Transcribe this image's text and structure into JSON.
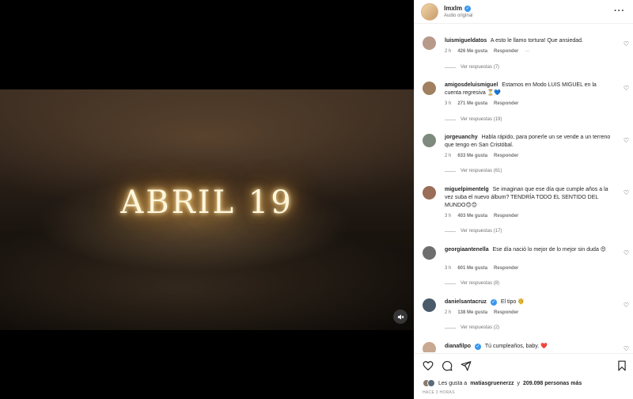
{
  "video": {
    "title_text": "ABRIL 19"
  },
  "post_header": {
    "username": "lmxlm",
    "audio": "Audio original"
  },
  "comments": [
    {
      "user": "luismigueldatos",
      "text": "A esto le llamo tortura! Que ansiedad.",
      "time": "2 h",
      "likes": "426 Me gusta",
      "reply": "Responder",
      "extra": "···",
      "replies": "Ver respuestas (7)"
    },
    {
      "user": "amigosdeluismiguel",
      "text": "Estamos en Modo LUIS MIGUEL en la cuenta regresiva ⏳💙",
      "time": "3 h",
      "likes": "271 Me gusta",
      "reply": "Responder",
      "replies": "Ver respuestas (19)"
    },
    {
      "user": "jorgeuanchy",
      "text": "Habla rápido, para ponerle un se vende a un terreno que tengo en San Cristóbal.",
      "time": "2 h",
      "likes": "633 Me gusta",
      "reply": "Responder",
      "replies": "Ver respuestas (61)"
    },
    {
      "user": "miguelpimentelg",
      "text": "Se imaginan que ese día que cumple años a la vez suba el nuevo álbum? TENDRÍA TODO EL SENTIDO DEL MUNDO😊😊",
      "time": "3 h",
      "likes": "403 Me gusta",
      "reply": "Responder",
      "replies": "Ver respuestas (17)"
    },
    {
      "user": "georgiaantenella",
      "text": "Ese día nació lo mejor de lo mejor sin duda 😍",
      "time": "3 h",
      "likes": "601 Me gusta",
      "reply": "Responder",
      "replies": "Ver respuestas (8)"
    },
    {
      "user": "danielsantacruz",
      "text": "El tipo 🤴",
      "time": "2 h",
      "likes": "138 Me gusta",
      "reply": "Responder",
      "replies": "Ver respuestas (2)"
    },
    {
      "user": "dianafilpo",
      "text": "Tú cumpleaños, baby. ❤️"
    }
  ],
  "likes_summary": {
    "prefix": "Les gusta a",
    "user": "matiasgruenerzz",
    "middle": "y",
    "count": "209.098 personas más"
  },
  "timestamp": "HACE 3 HORAS",
  "colors": {
    "accent": "#3897f0",
    "text": "#262626",
    "muted": "#737373"
  }
}
